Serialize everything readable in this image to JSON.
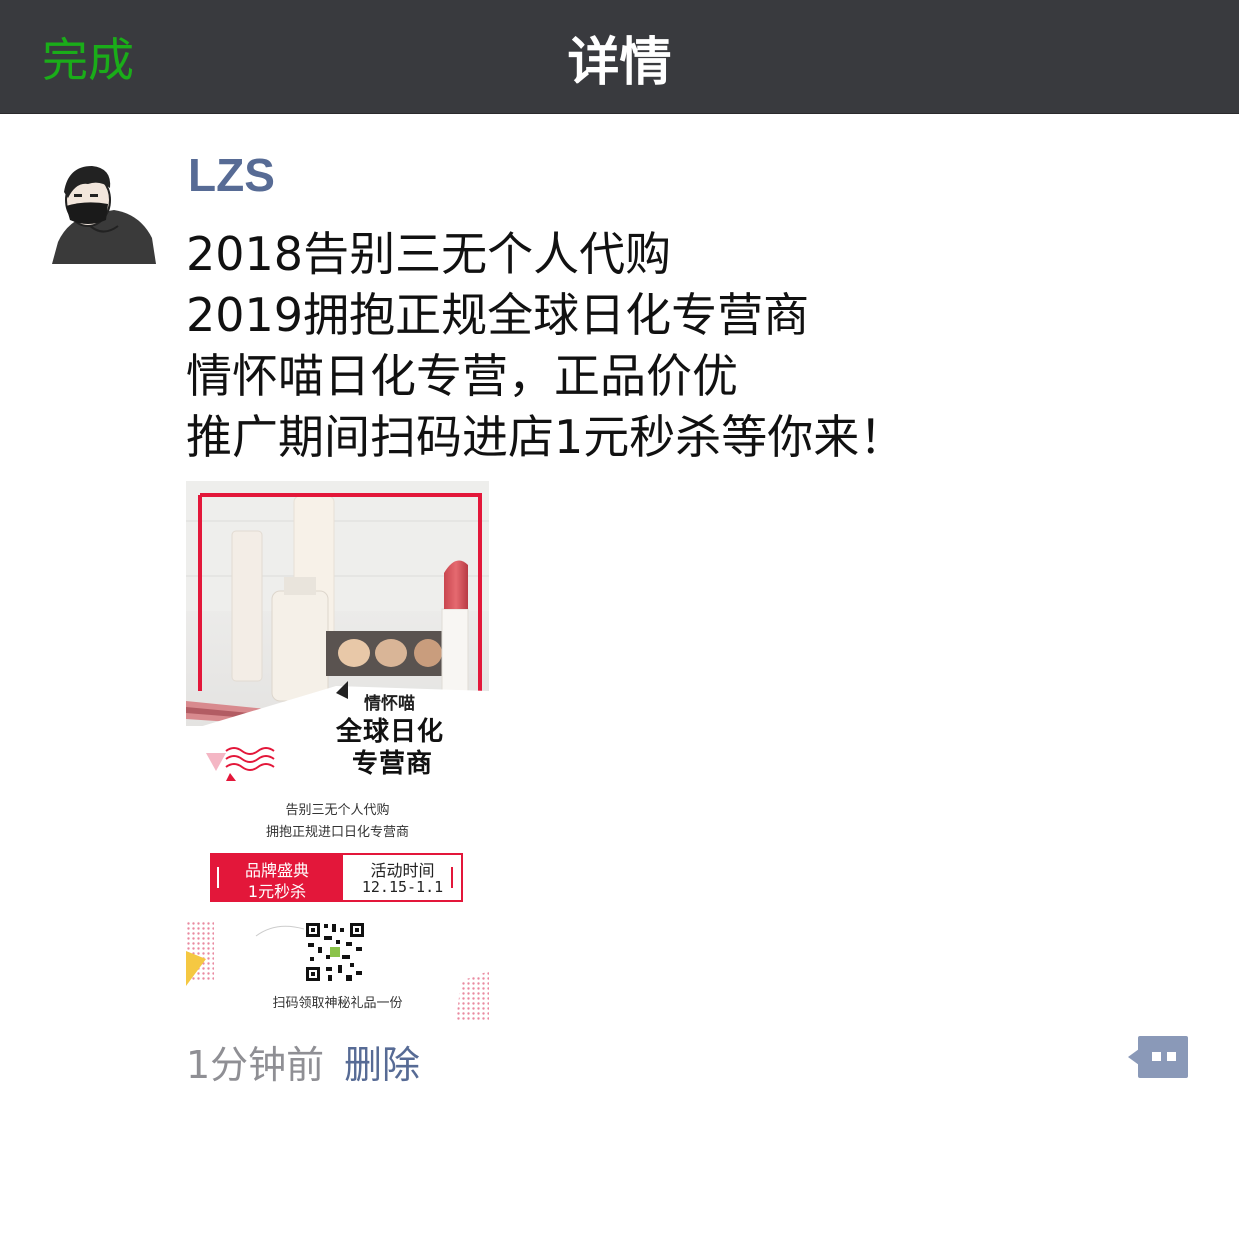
{
  "navbar": {
    "done_label": "完成",
    "title": "详情"
  },
  "post": {
    "username": "LZS",
    "lines": [
      "2018告别三无个人代购",
      "2019拥抱正规全球日化专营商",
      "情怀喵日化专营，正品价优",
      "推广期间扫码进店1元秒杀等你来！"
    ],
    "time": "1分钟前",
    "delete_label": "删除"
  },
  "poster": {
    "brand": "情怀喵",
    "headline_1": "全球日化",
    "headline_2": "专营商",
    "slogan_1": "告别三无个人代购",
    "slogan_2": "拥抱正规进口日化专营商",
    "promo_left_1": "品牌盛典",
    "promo_left_2": "1元秒杀",
    "promo_right_1": "活动时间",
    "promo_right_2": "12.15-1.1",
    "scan_text": "扫码领取神秘礼品一份"
  },
  "colors": {
    "navbar_bg": "#393a3e",
    "done_green": "#1aad19",
    "link_blue": "#576b95",
    "poster_red": "#e3173a"
  }
}
